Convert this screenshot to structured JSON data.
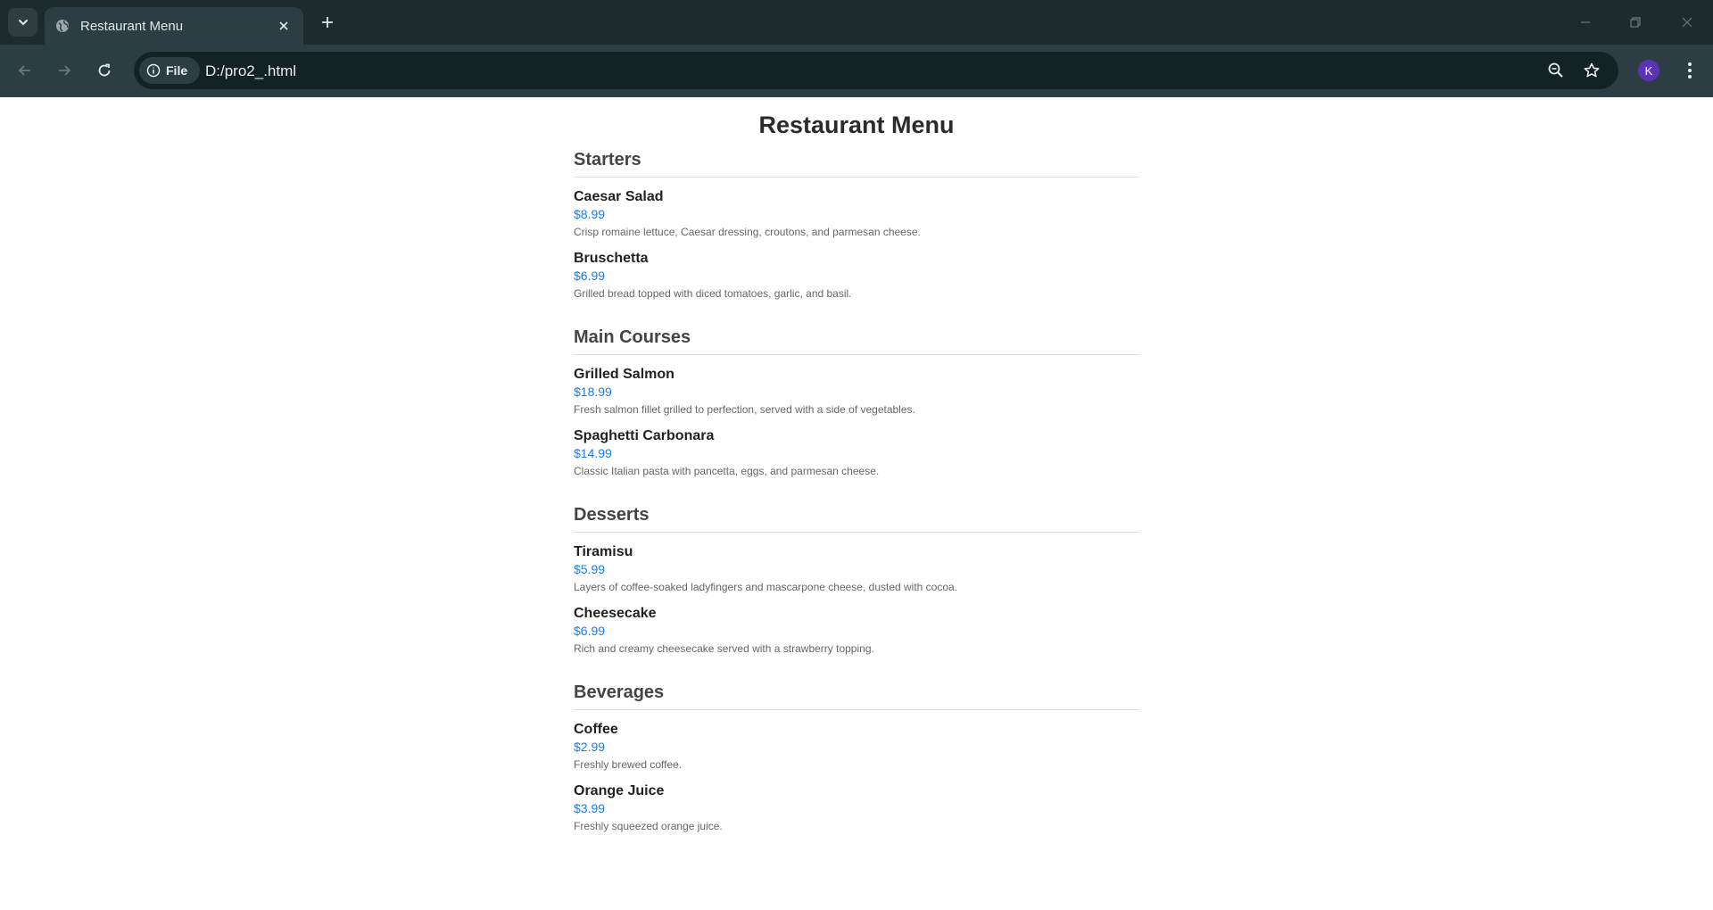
{
  "browser": {
    "tab_title": "Restaurant Menu",
    "site_chip_label": "File",
    "url": "D:/pro2_.html",
    "profile_initial": "K"
  },
  "menu": {
    "title": "Restaurant Menu",
    "sections": [
      {
        "title": "Starters",
        "items": [
          {
            "name": "Caesar Salad",
            "price": "$8.99",
            "description": "Crisp romaine lettuce, Caesar dressing, croutons, and parmesan cheese."
          },
          {
            "name": "Bruschetta",
            "price": "$6.99",
            "description": "Grilled bread topped with diced tomatoes, garlic, and basil."
          }
        ]
      },
      {
        "title": "Main Courses",
        "items": [
          {
            "name": "Grilled Salmon",
            "price": "$18.99",
            "description": "Fresh salmon fillet grilled to perfection, served with a side of vegetables."
          },
          {
            "name": "Spaghetti Carbonara",
            "price": "$14.99",
            "description": "Classic Italian pasta with pancetta, eggs, and parmesan cheese."
          }
        ]
      },
      {
        "title": "Desserts",
        "items": [
          {
            "name": "Tiramisu",
            "price": "$5.99",
            "description": "Layers of coffee-soaked ladyfingers and mascarpone cheese, dusted with cocoa."
          },
          {
            "name": "Cheesecake",
            "price": "$6.99",
            "description": "Rich and creamy cheesecake served with a strawberry topping."
          }
        ]
      },
      {
        "title": "Beverages",
        "items": [
          {
            "name": "Coffee",
            "price": "$2.99",
            "description": "Freshly brewed coffee."
          },
          {
            "name": "Orange Juice",
            "price": "$3.99",
            "description": "Freshly squeezed orange juice."
          }
        ]
      }
    ]
  },
  "colors": {
    "price": "#1e7be0",
    "tabstrip_bg": "#1e2b2e",
    "toolbar_bg": "#2c3e43",
    "avatar_bg": "#5b34b4"
  }
}
